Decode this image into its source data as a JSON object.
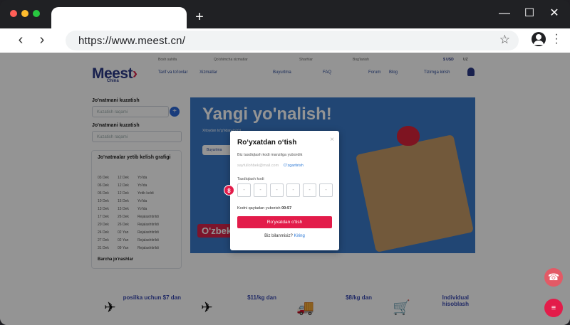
{
  "browser": {
    "url": "https://www.meest.cn/",
    "new_tab": "+",
    "controls": {
      "minimize": "—",
      "maximize": "☐",
      "close": "✕"
    },
    "back": "‹",
    "forward": "›",
    "colors": {
      "red": "#ff5f57",
      "yellow": "#febc2e",
      "green": "#28c840"
    }
  },
  "site": {
    "logo_main": "Meest",
    "logo_sub": "China",
    "currency": "$ USD",
    "lang": "UZ",
    "top_links": [
      "Bosh sahifa",
      "Qo'shimcha xizmatlar",
      "Sharhlar",
      "Bog'lanish"
    ],
    "nav": [
      "Tarif va to'lovlar",
      "Xizmatlar",
      "Buyurtma",
      "FAQ",
      "Forum",
      "Blog",
      "Tizimga kirish"
    ],
    "tracking_title": "Jo'natmani kuzatish",
    "tracking_placeholder": "Kuzatish raqami",
    "tracking_title2": "Jo'natmani kuzatish",
    "tracking_placeholder2": "Kuzatish raqami",
    "schedule_title": "Jo'natmalar yetib kelish grafigi",
    "schedule_rows": [
      [
        "03 Dek",
        "12 Dek",
        "Yo'lda"
      ],
      [
        "06 Dek",
        "12 Dek",
        "Yo'lda"
      ],
      [
        "06 Dek",
        "12 Dek",
        "Yetib keldi"
      ],
      [
        "10 Dek",
        "15 Dek",
        "Yo'lda"
      ],
      [
        "13 Dek",
        "15 Dek",
        "Yo'lda"
      ],
      [
        "17 Dek",
        "26 Dek",
        "Rejalashtirildi"
      ],
      [
        "20 Dek",
        "26 Dek",
        "Rejalashtirildi"
      ],
      [
        "24 Dek",
        "02 Yan",
        "Rejalashtirildi"
      ],
      [
        "27 Dek",
        "02 Yan",
        "Rejalashtirildi"
      ],
      [
        "31 Dek",
        "09 Yan",
        "Rejalashtirildi"
      ]
    ],
    "all_shipments": "Barcha jo'nashlar",
    "hero_title": "Yangi yo'nalish!",
    "hero_sub": "Xitoydan to'g'ridan-to'g'ri",
    "hero_cta": "Buyurtma",
    "hero_banner": "O'zbek",
    "features": [
      {
        "icon": "plane-icon",
        "text": "posilka uchun $7 dan"
      },
      {
        "icon": "plane-icon",
        "text": "$11/kg dan"
      },
      {
        "icon": "truck-icon",
        "text": "$8/kg dan"
      },
      {
        "icon": "cart-icon",
        "text": "Individual hisoblash"
      }
    ]
  },
  "modal": {
    "title": "Roʻyxatdan oʻtish",
    "close": "×",
    "info": "Biz tasdiqlash kodi manzilga yubordik",
    "email": "sayfullohbek@mail.com",
    "change": "Oʻzgartirish",
    "code_label": "Tasdiqlash kodi",
    "digit_placeholder": "-",
    "resend_text": "Kodni qaytadan yuborish",
    "resend_timer": "00:57",
    "submit": "Roʻyxatdan oʻtish",
    "known_text": "Biz bilanmisiz?",
    "login": "Kiring"
  },
  "step_badge": "8"
}
